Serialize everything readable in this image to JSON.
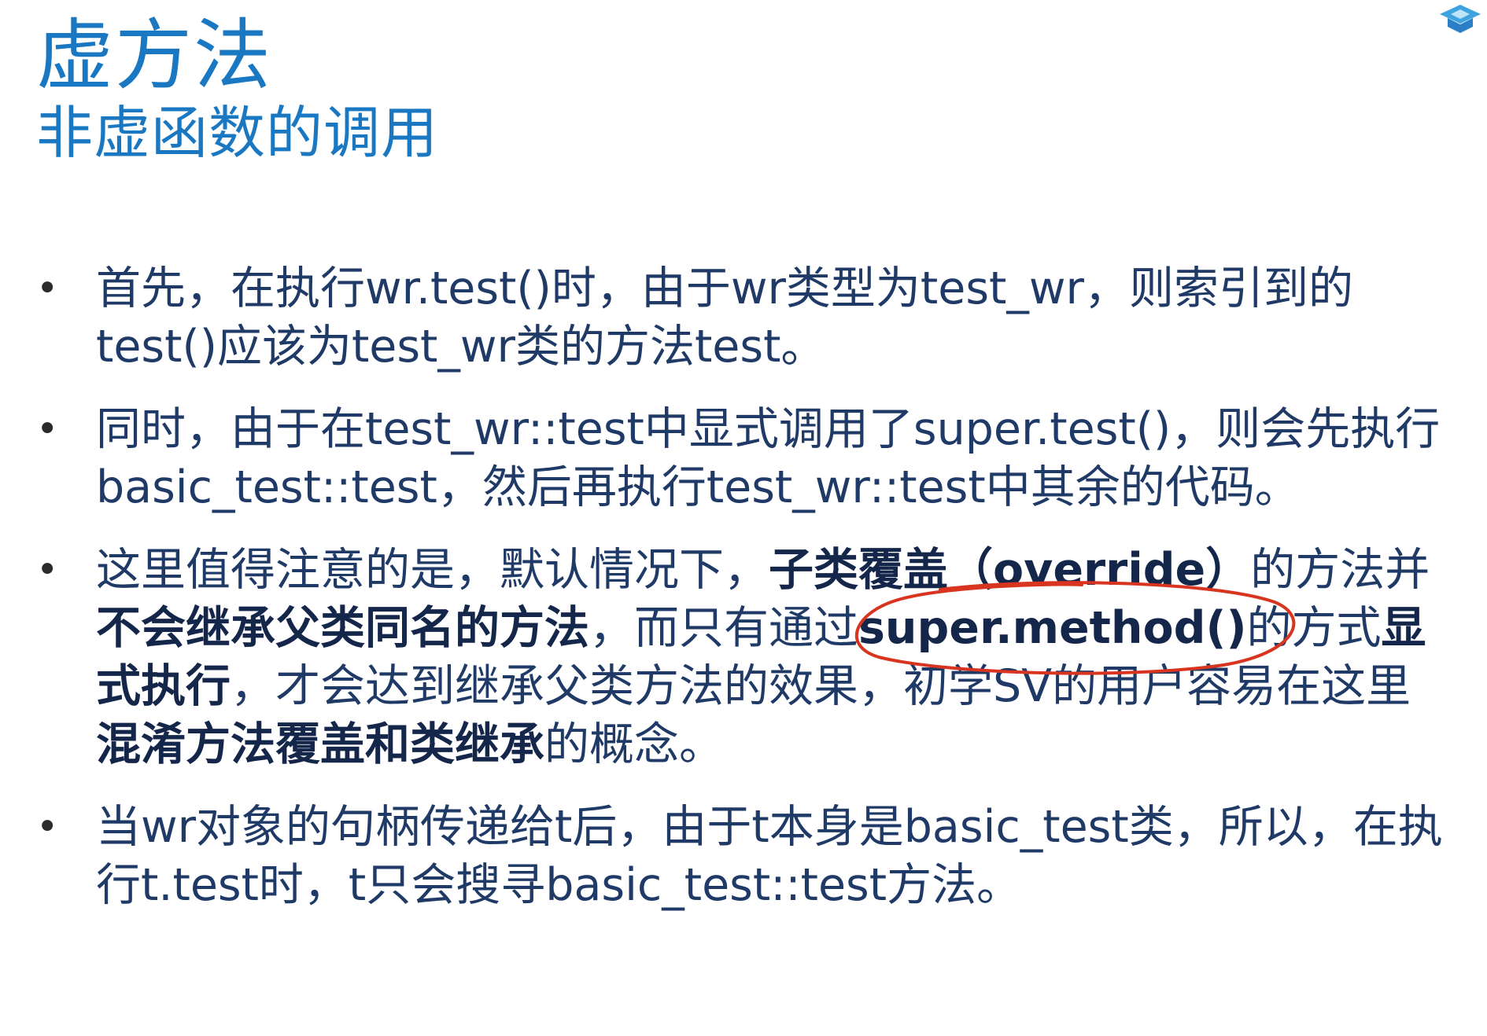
{
  "title": "虚方法",
  "subtitle": "非虚函数的调用",
  "bullets": [
    {
      "segments": [
        {
          "text": "首先，在执行wr.test()时，由于wr类型为test_wr，则索引到的test()应该为test_wr类的方法test。",
          "bold": false
        }
      ]
    },
    {
      "segments": [
        {
          "text": "同时，由于在test_wr::test中显式调用了super.test()，则会先执行basic_test::test，然后再执行test_wr::test中其余的代码。",
          "bold": false
        }
      ]
    },
    {
      "segments": [
        {
          "text": "这里值得注意的是，默认情况下，",
          "bold": false
        },
        {
          "text": "子类覆盖（override）",
          "bold": true
        },
        {
          "text": "的方法并",
          "bold": false
        },
        {
          "text": "不会继承父类同名的方法",
          "bold": true
        },
        {
          "text": "，而只有通过",
          "bold": false
        },
        {
          "text": "super.method()",
          "bold": true
        },
        {
          "text": "的方式",
          "bold": false
        },
        {
          "text": "显式执行",
          "bold": true
        },
        {
          "text": "，才会达到继承父类方法的效果，初学SV的用户容易在这里",
          "bold": false
        },
        {
          "text": "混淆方法覆盖和类继承",
          "bold": true
        },
        {
          "text": "的概念。",
          "bold": false
        }
      ]
    },
    {
      "segments": [
        {
          "text": "当wr对象的句柄传递给t后，由于t本身是basic_test类，所以，在执行t.test时，t只会搜寻basic_test::test方法。",
          "bold": false
        }
      ]
    }
  ],
  "colors": {
    "title": "#1a78c2",
    "body_text": "#1f3a66",
    "annotation_ink": "#d9341f"
  },
  "icons": {
    "corner_logo": "graduation-cap-icon",
    "bullet_marker": "bullet-dot-icon"
  }
}
